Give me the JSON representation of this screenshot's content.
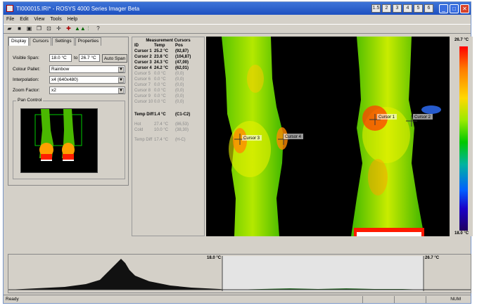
{
  "window": {
    "title": "TI000015.IRI* - ROSYS 4000 Series Imager Beta",
    "tray": [
      "1.5",
      "2",
      "3",
      "4",
      "5",
      "6"
    ]
  },
  "menu": [
    "File",
    "Edit",
    "View",
    "Tools",
    "Help"
  ],
  "toolbar_icons": [
    "open-icon",
    "save-icon",
    "print-icon",
    "copy-icon",
    "zoom-icon",
    "crosshair-icon",
    "cursor-icon",
    "pair-icon",
    "chart-icon",
    "help-icon"
  ],
  "tabs": [
    "Display",
    "Cursors",
    "Settings",
    "Properties"
  ],
  "display": {
    "visible_span_label": "Visible Span:",
    "span_from": "18.0 °C",
    "span_to_label": "to",
    "span_to": "26.7 °C",
    "auto_span": "Auto Span",
    "colour_palette_label": "Colour Pallet:",
    "colour_palette": "Rainbow",
    "interpolation_label": "Interpolation:",
    "interpolation": "x4 (640x480)",
    "zoom_label": "Zoom Factor:",
    "zoom": "x2",
    "pan_control": "Pan Control"
  },
  "cursors": {
    "title": "Measurement Cursors",
    "headers": [
      "ID",
      "Temp",
      "Pos"
    ],
    "rows": [
      {
        "id": "Cursor 1",
        "temp": "25.2 °C",
        "pos": "(92,87)",
        "active": true
      },
      {
        "id": "Cursor 2",
        "temp": "23.8 °C",
        "pos": "(104,87)",
        "active": true
      },
      {
        "id": "Cursor 3",
        "temp": "24.3 °C",
        "pos": "(47,00)",
        "active": true
      },
      {
        "id": "Cursor 4",
        "temp": "24.2 °C",
        "pos": "(62,01)",
        "active": true
      },
      {
        "id": "Cursor 5",
        "temp": "0.0 °C",
        "pos": "(0,0)",
        "active": false
      },
      {
        "id": "Cursor 6",
        "temp": "0.0 °C",
        "pos": "(0,0)",
        "active": false
      },
      {
        "id": "Cursor 7",
        "temp": "0.0 °C",
        "pos": "(0,0)",
        "active": false
      },
      {
        "id": "Cursor 8",
        "temp": "0.0 °C",
        "pos": "(0,0)",
        "active": false
      },
      {
        "id": "Cursor 9",
        "temp": "0.0 °C",
        "pos": "(0,0)",
        "active": false
      },
      {
        "id": "Cursor 10",
        "temp": "0.0 °C",
        "pos": "(0,0)",
        "active": false
      }
    ],
    "temp_diff_label": "Temp Diff",
    "temp_diff": "1.4 °C",
    "temp_diff_pair": "(C1-C2)",
    "hot_label": "Hot",
    "hot": "27.4 °C",
    "hot_pos": "(86,53)",
    "cold_label": "Cold",
    "cold": "10.0 °C",
    "cold_pos": "(38,30)",
    "temp_diff2_label": "Temp Diff",
    "temp_diff2": "17.4 °C",
    "temp_diff2_pair": "(H-C)"
  },
  "thermal_markers": [
    "Cursor 1",
    "Cursor 2",
    "Cursor 3",
    "Cursor 4"
  ],
  "scale": {
    "max": "26.7 °C",
    "min": "18.0 °C"
  },
  "histogram": {
    "low": "18.0 °C",
    "high": "26.7 °C"
  },
  "status": {
    "left": "Ready",
    "right": "NUM"
  }
}
